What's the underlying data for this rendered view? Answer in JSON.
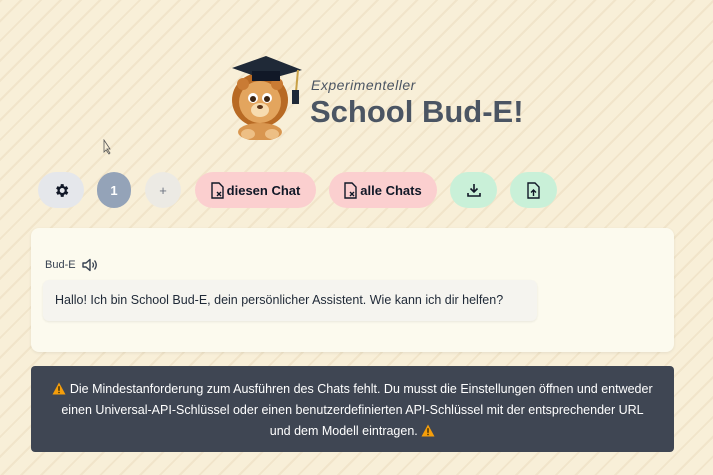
{
  "header": {
    "subtitle": "Experimenteller",
    "title": "School Bud-E!"
  },
  "toolbar": {
    "settings_icon": "gear-icon",
    "chat_number": "1",
    "add_label": "+",
    "delete_chat_label": "diesen Chat",
    "delete_all_label": "alle Chats",
    "download_icon": "download-icon",
    "upload_icon": "upload-file-icon"
  },
  "chat": {
    "sender": "Bud-E",
    "message": "Hallo! Ich bin School Bud-E, dein persönlicher Assistent. Wie kann ich dir helfen?"
  },
  "warning": {
    "text": "Die Mindestanforderung zum Ausführen des Chats fehlt. Du musst die Einstellungen öffnen und entweder einen Universal-API-Schlüssel oder einen benutzerdefinierten API-Schlüssel mit der entsprechender URL und dem Modell eintragen."
  },
  "colors": {
    "background": "#f8efd8",
    "delete_buttons": "#fbcfcf",
    "file_buttons": "#c9f0d8",
    "warning_bg": "#3f4653",
    "warning_icon": "#f59e0b"
  }
}
